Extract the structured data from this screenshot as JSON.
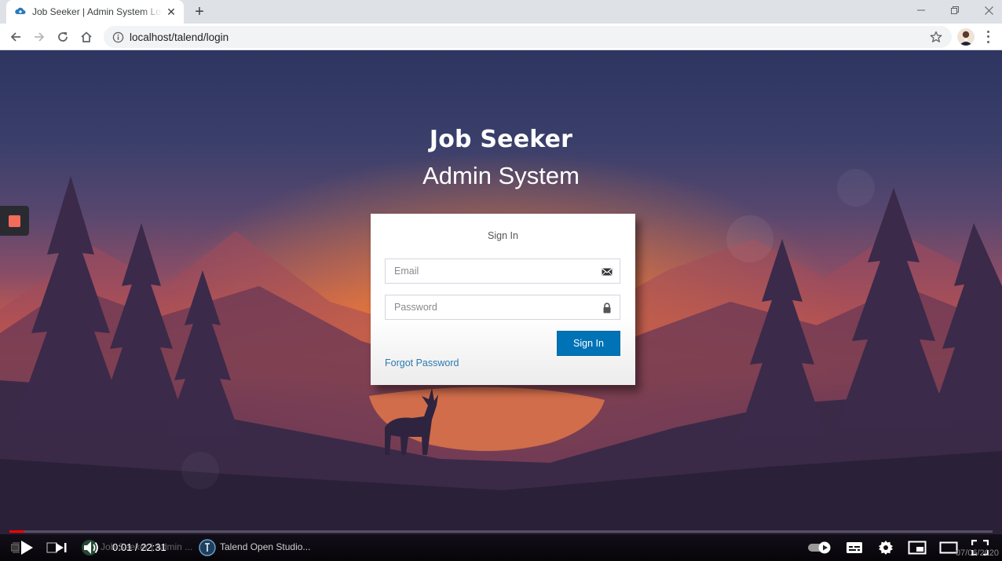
{
  "browser": {
    "tab_title": "Job Seeker | Admin System Log in",
    "url": "localhost/talend/login",
    "icons": {
      "favicon": "cloud-favicon-icon",
      "close": "close-icon",
      "new_tab": "plus-icon",
      "back": "arrow-left-icon",
      "forward": "arrow-right-icon",
      "reload": "reload-icon",
      "home": "home-icon",
      "info": "info-icon",
      "bookmark": "star-icon",
      "profile": "avatar",
      "menu": "kebab-menu-icon"
    }
  },
  "hero": {
    "title": "Job Seeker",
    "subtitle": "Admin System"
  },
  "login": {
    "heading": "Sign In",
    "email_placeholder": "Email",
    "password_placeholder": "Password",
    "submit_label": "Sign In",
    "forgot_label": "Forgot Password",
    "colors": {
      "primary": "#0073b7",
      "link": "#2a7ab0"
    }
  },
  "player": {
    "time": "0:01 / 22:31",
    "progress_fraction": 0.0007,
    "taskbar_items": [
      "Job Seeker | Admin ...",
      "Talend Open Studio..."
    ],
    "date_partial": "07/06/2020",
    "colors": {
      "progress": "#ff0000",
      "record": "#f26b5b"
    }
  }
}
